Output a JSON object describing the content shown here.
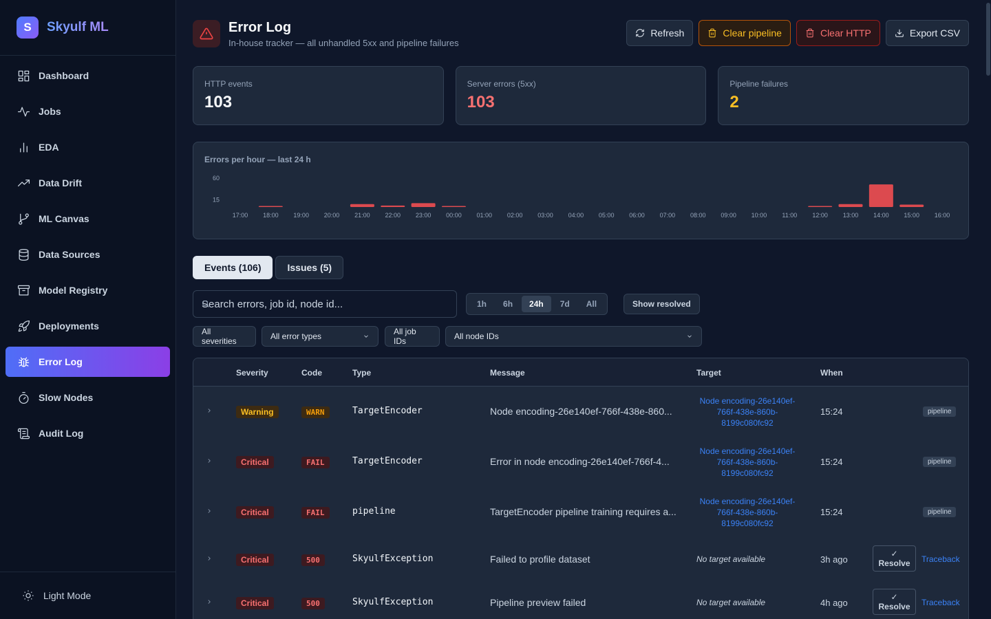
{
  "brand": {
    "logo_letter": "S",
    "name": "Skyulf ML"
  },
  "sidebar": {
    "items": [
      {
        "label": "Dashboard",
        "icon": "dashboard-icon"
      },
      {
        "label": "Jobs",
        "icon": "activity-icon"
      },
      {
        "label": "EDA",
        "icon": "bar-chart-icon"
      },
      {
        "label": "Data Drift",
        "icon": "trending-up-icon"
      },
      {
        "label": "ML Canvas",
        "icon": "git-branch-icon"
      },
      {
        "label": "Data Sources",
        "icon": "database-icon"
      },
      {
        "label": "Model Registry",
        "icon": "archive-icon"
      },
      {
        "label": "Deployments",
        "icon": "rocket-icon"
      },
      {
        "label": "Error Log",
        "icon": "bug-icon",
        "active": true
      },
      {
        "label": "Slow Nodes",
        "icon": "timer-icon"
      },
      {
        "label": "Audit Log",
        "icon": "scroll-icon"
      }
    ],
    "footer_label": "Light Mode"
  },
  "header": {
    "title": "Error Log",
    "subtitle": "In-house tracker — all unhandled 5xx and pipeline failures"
  },
  "actions": {
    "refresh": "Refresh",
    "clear_pipeline": "Clear pipeline",
    "clear_http": "Clear HTTP",
    "export_csv": "Export CSV"
  },
  "stats": [
    {
      "label": "HTTP events",
      "value": "103",
      "color": "#f8fafc"
    },
    {
      "label": "Server errors (5xx)",
      "value": "103",
      "color": "#f87171"
    },
    {
      "label": "Pipeline failures",
      "value": "2",
      "color": "#fbbf24"
    }
  ],
  "chart_data": {
    "type": "bar",
    "title": "Errors per hour — last 24 h",
    "yticks": [
      15,
      60
    ],
    "bar_color": "#dc4a4f",
    "categories": [
      "17:00",
      "18:00",
      "19:00",
      "20:00",
      "21:00",
      "22:00",
      "23:00",
      "00:00",
      "01:00",
      "02:00",
      "03:00",
      "04:00",
      "05:00",
      "06:00",
      "07:00",
      "08:00",
      "09:00",
      "10:00",
      "11:00",
      "12:00",
      "13:00",
      "14:00",
      "15:00",
      "16:00"
    ],
    "values": [
      0,
      1,
      0,
      0,
      6,
      3,
      8,
      2,
      0,
      0,
      0,
      0,
      0,
      0,
      0,
      0,
      0,
      0,
      0,
      2,
      6,
      47,
      5,
      0
    ]
  },
  "tabs": [
    {
      "label": "Events (106)",
      "active": true
    },
    {
      "label": "Issues (5)",
      "active": false
    }
  ],
  "search": {
    "placeholder": "Search errors, job id, node id..."
  },
  "ranges": [
    {
      "label": "1h"
    },
    {
      "label": "6h"
    },
    {
      "label": "24h",
      "active": true
    },
    {
      "label": "7d"
    },
    {
      "label": "All"
    }
  ],
  "show_resolved": "Show resolved",
  "filters": {
    "severities": "All severities",
    "error_types": "All error types",
    "job_ids": "All job IDs",
    "node_ids": "All node IDs"
  },
  "table": {
    "headers": {
      "severity": "Severity",
      "code": "Code",
      "type": "Type",
      "message": "Message",
      "target": "Target",
      "when": "When"
    },
    "rows": [
      {
        "severity": "Warning",
        "sev_class": "warning",
        "code": "WARN",
        "code_class": "warn",
        "type": "TargetEncoder",
        "message": "Node encoding-26e140ef-766f-438e-860...",
        "target": "Node encoding-26e140ef-766f-438e-860b-8199c080fc92",
        "when": "15:24",
        "source": "pipeline"
      },
      {
        "severity": "Critical",
        "sev_class": "critical",
        "code": "FAIL",
        "code_class": "fail",
        "type": "TargetEncoder",
        "message": "Error in node encoding-26e140ef-766f-4...",
        "target": "Node encoding-26e140ef-766f-438e-860b-8199c080fc92",
        "when": "15:24",
        "source": "pipeline"
      },
      {
        "severity": "Critical",
        "sev_class": "critical",
        "code": "FAIL",
        "code_class": "fail",
        "type": "pipeline",
        "message": "TargetEncoder pipeline training requires a...",
        "target": "Node encoding-26e140ef-766f-438e-860b-8199c080fc92",
        "when": "15:24",
        "source": "pipeline"
      },
      {
        "severity": "Critical",
        "sev_class": "critical",
        "code": "500",
        "code_class": "fail",
        "type": "SkyulfException",
        "message": "Failed to profile dataset",
        "target": "No target available",
        "when": "3h ago",
        "resolve": "Resolve",
        "traceback": "Traceback"
      },
      {
        "severity": "Critical",
        "sev_class": "critical",
        "code": "500",
        "code_class": "fail",
        "type": "SkyulfException",
        "message": "Pipeline preview failed",
        "target": "No target available",
        "when": "4h ago",
        "resolve": "Resolve",
        "traceback": "Traceback"
      }
    ]
  }
}
